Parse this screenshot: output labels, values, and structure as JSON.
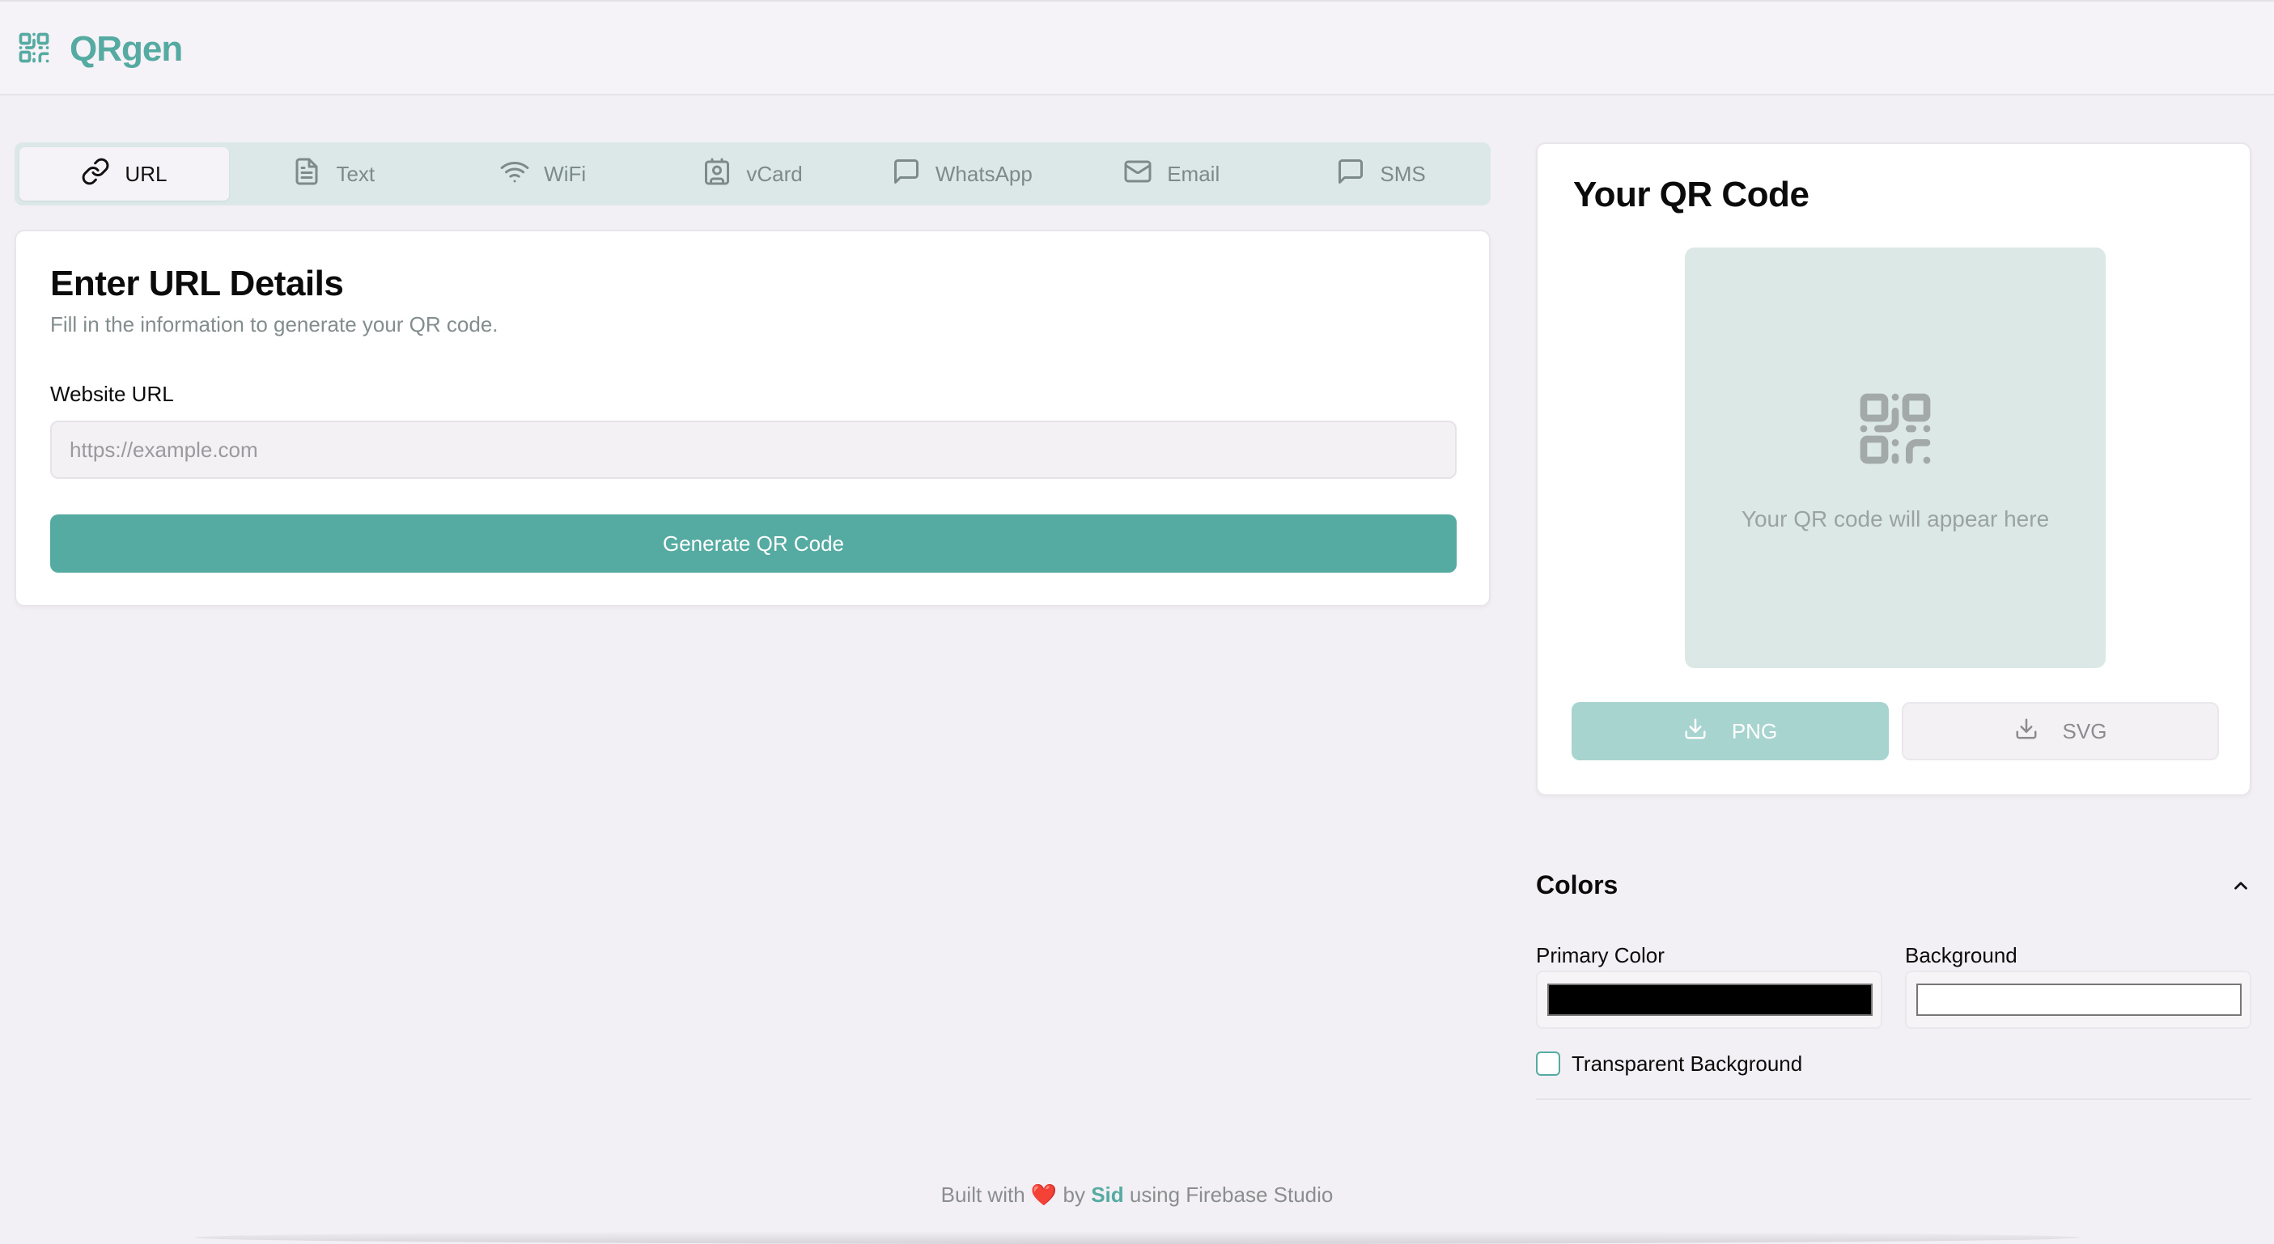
{
  "app": {
    "name": "QRgen",
    "brand_color": "#55aba1"
  },
  "tabs": [
    {
      "label": "URL",
      "icon": "link-icon",
      "active": true
    },
    {
      "label": "Text",
      "icon": "file-text-icon",
      "active": false
    },
    {
      "label": "WiFi",
      "icon": "wifi-icon",
      "active": false
    },
    {
      "label": "vCard",
      "icon": "contact-card-icon",
      "active": false
    },
    {
      "label": "WhatsApp",
      "icon": "message-icon",
      "active": false
    },
    {
      "label": "Email",
      "icon": "mail-icon",
      "active": false
    },
    {
      "label": "SMS",
      "icon": "message-icon",
      "active": false
    }
  ],
  "form": {
    "title": "Enter URL Details",
    "subtitle": "Fill in the information to generate your QR code.",
    "url_label": "Website URL",
    "url_placeholder": "https://example.com",
    "url_value": "",
    "generate_label": "Generate QR Code"
  },
  "preview": {
    "title": "Your QR Code",
    "placeholder_text": "Your QR code will appear here",
    "png_label": "PNG",
    "svg_label": "SVG"
  },
  "colors": {
    "title": "Colors",
    "expanded": true,
    "primary_label": "Primary Color",
    "primary_value": "#000000",
    "background_label": "Background",
    "background_value": "#ffffff",
    "transparent_label": "Transparent Background",
    "transparent_checked": false
  },
  "footer": {
    "prefix": "Built with",
    "heart": "❤️",
    "by": "by",
    "author": "Sid",
    "suffix": "using Firebase Studio"
  }
}
